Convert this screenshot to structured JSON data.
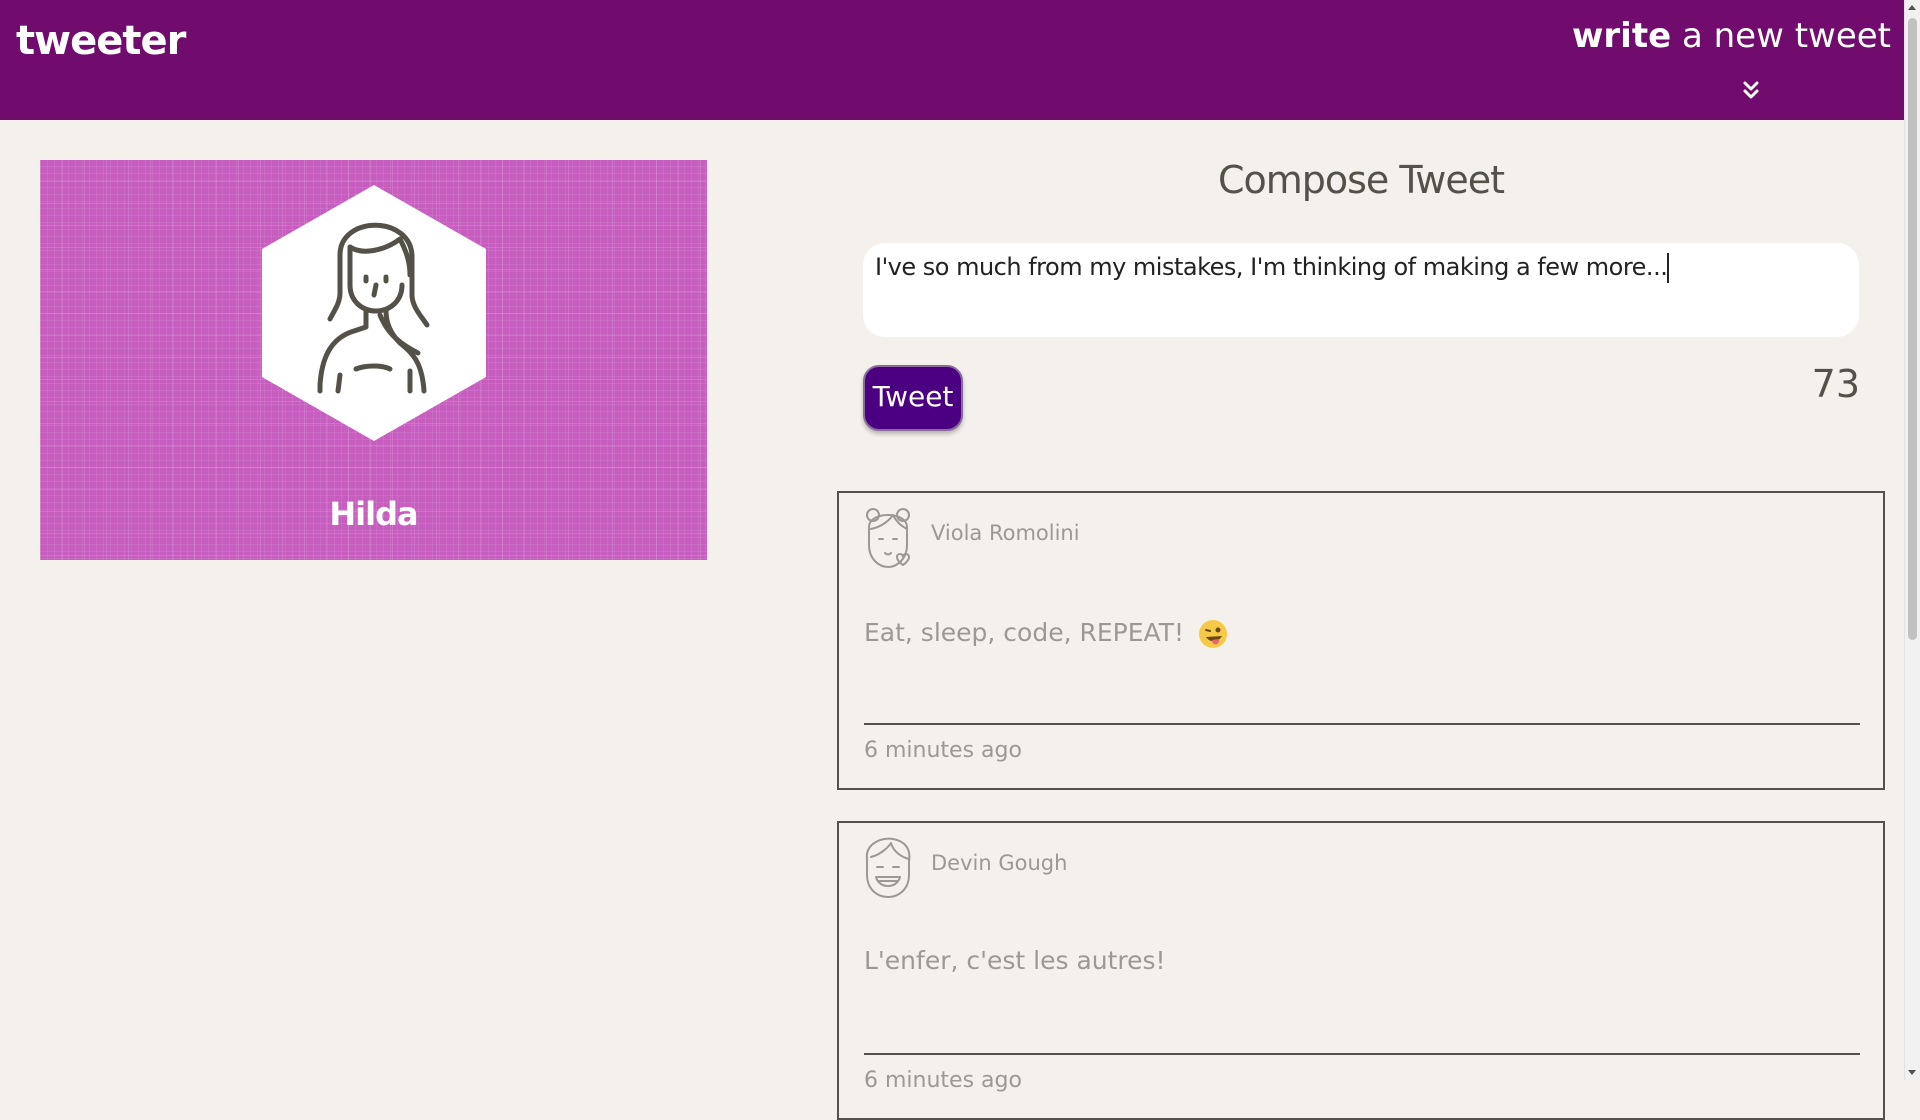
{
  "nav": {
    "brand": "tweeter",
    "write_bold": "write",
    "write_rest": " a new tweet",
    "chevron_icon": "double-chevron-down-icon"
  },
  "profile": {
    "name": "Hilda",
    "avatar_icon": "woman-avatar-icon",
    "background_color": "#c65dbf"
  },
  "compose": {
    "title": "Compose Tweet",
    "text": "I've so much from my mistakes, I'm thinking of making a few more...",
    "button_label": "Tweet",
    "counter": "73"
  },
  "tweets": [
    {
      "author": "Viola Romolini",
      "avatar_icon": "girl-avatar-icon",
      "content": "Eat, sleep, code, REPEAT!",
      "emoji": "winking-tongue-emoji",
      "time": "6 minutes ago"
    },
    {
      "author": "Devin Gough",
      "avatar_icon": "boy-avatar-icon",
      "content": "L'enfer, c'est les autres!",
      "time": "6 minutes ago"
    }
  ],
  "colors": {
    "nav": "#720b6e",
    "page": "#f4f1ec",
    "button": "#4b0082",
    "text": "#545149",
    "muted": "#9b9895"
  }
}
